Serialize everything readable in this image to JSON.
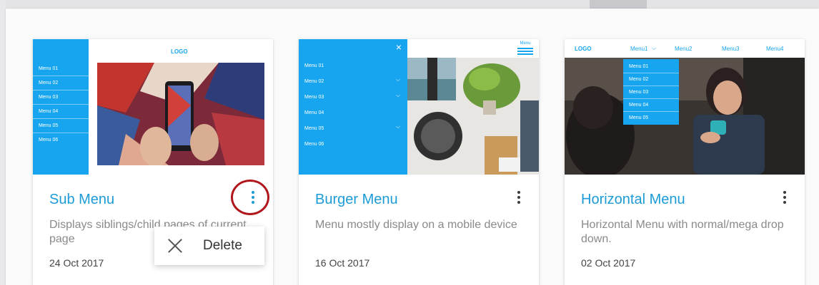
{
  "cards": [
    {
      "title": "Sub Menu",
      "description": "Displays siblings/child pages of current page",
      "date": "24 Oct 2017",
      "preview": {
        "logo": "LOGO",
        "menu_items": [
          "Menu 01",
          "Menu 02",
          "Menu 03",
          "Menu 04",
          "Menu 05",
          "Menu 06"
        ]
      },
      "menu_open": true
    },
    {
      "title": "Burger Menu",
      "description": "Menu mostly display on a mobile device",
      "date": "16 Oct 2017",
      "preview": {
        "menu_items": [
          "Menu 01",
          "Menu 02",
          "Menu 03",
          "Menu 04",
          "Menu 05",
          "Menu 06"
        ],
        "hamburger_label": "Menu",
        "close_glyph": "×"
      },
      "menu_open": false
    },
    {
      "title": "Horizontal Menu",
      "description": "Horizontal Menu with normal/mega drop down.",
      "date": "02 Oct 2017",
      "preview": {
        "logo": "LOGO",
        "nav_items": [
          "Menu1",
          "Menu2",
          "Menu3",
          "Menu4"
        ],
        "dropdown_items": [
          "Menu 01",
          "Menu 02",
          "Menu 03",
          "Menu 04",
          "Menu 05"
        ]
      },
      "menu_open": false
    }
  ],
  "context_menu": {
    "delete_label": "Delete",
    "icon": "close-icon"
  },
  "colors": {
    "accent": "#16a5ee",
    "title": "#1c9bd6",
    "highlight_ring": "#b0171c"
  }
}
